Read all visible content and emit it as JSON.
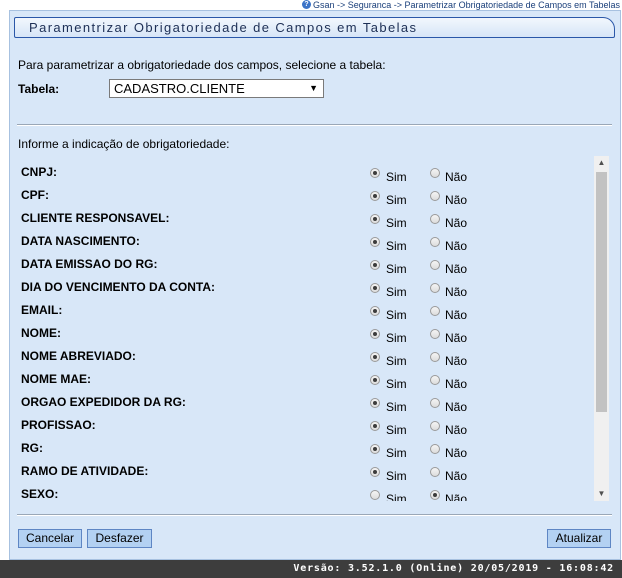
{
  "breadcrumb": "Gsan -> Seguranca -> Parametrizar Obrigatoriedade de Campos em Tabelas",
  "title": "Paramentrizar Obrigatoriedade de Campos em Tabelas",
  "intro": "Para parametrizar a obrigatoriedade dos campos, selecione a tabela:",
  "tabela_label": "Tabela:",
  "tabela_value": "CADASTRO.CLIENTE",
  "info": "Informe a indicação de obrigatoriedade:",
  "options": {
    "sim": "Sim",
    "nao": "Não"
  },
  "fields": [
    {
      "label": "CNPJ:",
      "value": "sim"
    },
    {
      "label": "CPF:",
      "value": "sim"
    },
    {
      "label": "CLIENTE RESPONSAVEL:",
      "value": "sim"
    },
    {
      "label": "DATA NASCIMENTO:",
      "value": "sim"
    },
    {
      "label": "DATA EMISSAO DO RG:",
      "value": "sim"
    },
    {
      "label": "DIA DO VENCIMENTO DA CONTA:",
      "value": "sim"
    },
    {
      "label": "EMAIL:",
      "value": "sim"
    },
    {
      "label": "NOME:",
      "value": "sim"
    },
    {
      "label": "NOME ABREVIADO:",
      "value": "sim"
    },
    {
      "label": "NOME MAE:",
      "value": "sim"
    },
    {
      "label": "ORGAO EXPEDIDOR DA RG:",
      "value": "sim"
    },
    {
      "label": "PROFISSAO:",
      "value": "sim"
    },
    {
      "label": "RG:",
      "value": "sim"
    },
    {
      "label": "RAMO DE ATIVIDADE:",
      "value": "sim"
    },
    {
      "label": "SEXO:",
      "value": "nao"
    }
  ],
  "buttons": {
    "cancel": "Cancelar",
    "undo": "Desfazer",
    "update": "Atualizar"
  },
  "footer": "Versão: 3.52.1.0 (Online) 20/05/2019 - 16:08:42"
}
